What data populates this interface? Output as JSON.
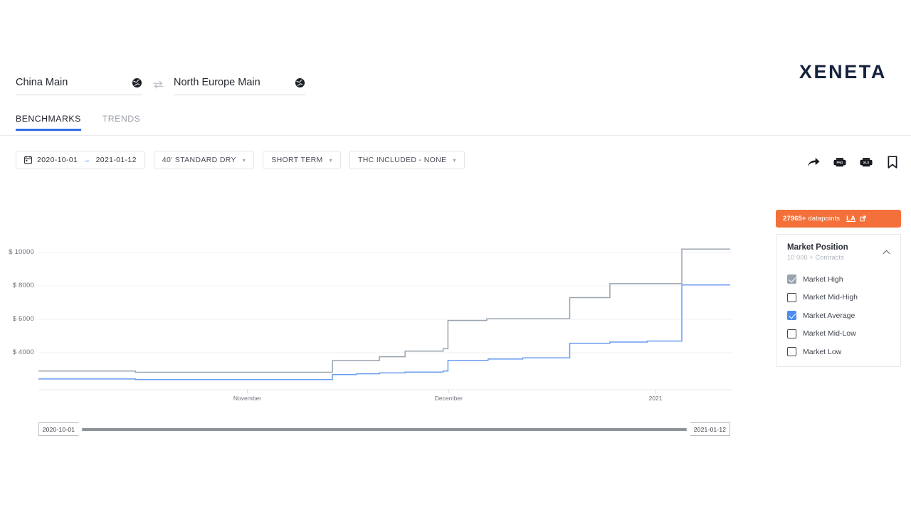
{
  "brand": {
    "name": "XENETA",
    "color": "#14223c"
  },
  "ports": {
    "origin": {
      "name": "China Main",
      "icon": "globe-icon"
    },
    "destination": {
      "name": "North Europe Main",
      "icon": "globe-icon"
    },
    "swap_icon": "swap-icon"
  },
  "tabs": [
    {
      "label": "BENCHMARKS",
      "active": true
    },
    {
      "label": "TRENDS",
      "active": false
    }
  ],
  "filters": {
    "date_range": {
      "icon": "calendar-icon",
      "from": "2020-10-01",
      "arrow": "→",
      "to": "2021-01-12"
    },
    "equipment": "40' STANDARD DRY",
    "term": "SHORT TERM",
    "thc": "THC INCLUDED - NONE"
  },
  "actions": [
    {
      "name": "share-icon",
      "label": "Share"
    },
    {
      "name": "download-png-icon",
      "label": "PNG"
    },
    {
      "name": "download-xls-icon",
      "label": "XLS"
    },
    {
      "name": "bookmark-icon",
      "label": "Bookmark"
    }
  ],
  "datapoints_badge": {
    "count_text": "27965+",
    "label": " datapoints",
    "link": "LA",
    "icon": "external-link-icon",
    "color": "#f4703a"
  },
  "market_position": {
    "title": "Market Position",
    "subtitle": "10 000 + Contracts",
    "collapse_icon": "chevron-up-icon",
    "options": [
      {
        "label": "Market High",
        "checked": true,
        "color": "#9aa4ae"
      },
      {
        "label": "Market Mid-High",
        "checked": false,
        "color": ""
      },
      {
        "label": "Market Average",
        "checked": true,
        "color": "#4a8cf0"
      },
      {
        "label": "Market Mid-Low",
        "checked": false,
        "color": ""
      },
      {
        "label": "Market Low",
        "checked": false,
        "color": ""
      }
    ]
  },
  "range_slider": {
    "left_label": "2020-10-01",
    "right_label": "2021-01-12"
  },
  "chart_data": {
    "type": "line",
    "title": "",
    "xlabel": "",
    "ylabel": "",
    "grid": true,
    "legend_position": "none",
    "ylim": [
      1500,
      10800
    ],
    "ytick_labels": [
      "$ 10000",
      "$ 8000",
      "$ 6000",
      "$ 4000"
    ],
    "ytick_values": [
      10000,
      8000,
      6000,
      4000
    ],
    "xtick_labels": [
      "November",
      "December",
      "2021"
    ],
    "xtick_positions": [
      0.302,
      0.593,
      0.892
    ],
    "x_range": [
      "2020-10-01",
      "2021-01-12"
    ],
    "series": [
      {
        "name": "Market High",
        "color": "#9aa4ae",
        "step": true,
        "points": [
          {
            "x": 0.0,
            "y": 2900
          },
          {
            "x": 0.14,
            "y": 2900
          },
          {
            "x": 0.14,
            "y": 2830
          },
          {
            "x": 0.425,
            "y": 2830
          },
          {
            "x": 0.425,
            "y": 3530
          },
          {
            "x": 0.493,
            "y": 3530
          },
          {
            "x": 0.493,
            "y": 3760
          },
          {
            "x": 0.53,
            "y": 3760
          },
          {
            "x": 0.53,
            "y": 4100
          },
          {
            "x": 0.585,
            "y": 4100
          },
          {
            "x": 0.585,
            "y": 4240
          },
          {
            "x": 0.592,
            "y": 4240
          },
          {
            "x": 0.592,
            "y": 5930
          },
          {
            "x": 0.648,
            "y": 5930
          },
          {
            "x": 0.648,
            "y": 6030
          },
          {
            "x": 0.768,
            "y": 6030
          },
          {
            "x": 0.768,
            "y": 7300
          },
          {
            "x": 0.826,
            "y": 7300
          },
          {
            "x": 0.826,
            "y": 8130
          },
          {
            "x": 0.93,
            "y": 8130
          },
          {
            "x": 0.93,
            "y": 10200
          },
          {
            "x": 1.0,
            "y": 10200
          }
        ]
      },
      {
        "name": "Market Average",
        "color": "#6a9cf0",
        "step": true,
        "points": [
          {
            "x": 0.0,
            "y": 2430
          },
          {
            "x": 0.14,
            "y": 2430
          },
          {
            "x": 0.14,
            "y": 2390
          },
          {
            "x": 0.425,
            "y": 2390
          },
          {
            "x": 0.425,
            "y": 2690
          },
          {
            "x": 0.46,
            "y": 2690
          },
          {
            "x": 0.46,
            "y": 2740
          },
          {
            "x": 0.493,
            "y": 2740
          },
          {
            "x": 0.493,
            "y": 2790
          },
          {
            "x": 0.53,
            "y": 2790
          },
          {
            "x": 0.53,
            "y": 2840
          },
          {
            "x": 0.585,
            "y": 2840
          },
          {
            "x": 0.585,
            "y": 2900
          },
          {
            "x": 0.592,
            "y": 2900
          },
          {
            "x": 0.592,
            "y": 3540
          },
          {
            "x": 0.65,
            "y": 3540
          },
          {
            "x": 0.65,
            "y": 3620
          },
          {
            "x": 0.7,
            "y": 3620
          },
          {
            "x": 0.7,
            "y": 3690
          },
          {
            "x": 0.768,
            "y": 3690
          },
          {
            "x": 0.768,
            "y": 4560
          },
          {
            "x": 0.826,
            "y": 4560
          },
          {
            "x": 0.826,
            "y": 4640
          },
          {
            "x": 0.88,
            "y": 4640
          },
          {
            "x": 0.88,
            "y": 4700
          },
          {
            "x": 0.93,
            "y": 4700
          },
          {
            "x": 0.93,
            "y": 8060
          },
          {
            "x": 1.0,
            "y": 8060
          }
        ]
      }
    ]
  }
}
